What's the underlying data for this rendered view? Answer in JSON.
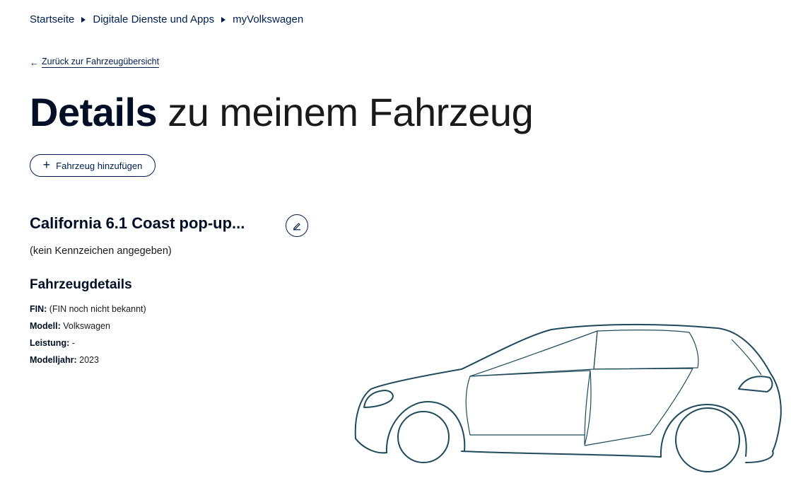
{
  "breadcrumb": {
    "items": [
      "Startseite",
      "Digitale Dienste und Apps",
      "myVolkswagen"
    ]
  },
  "back_link": {
    "label": "Zurück zur Fahrzeugübersicht",
    "icon": "arrow-left-icon"
  },
  "title": {
    "bold": "Details",
    "light": "zu meinem Fahrzeug"
  },
  "add_vehicle": {
    "label": "Fahrzeug hinzufügen",
    "icon": "plus-icon"
  },
  "vehicle": {
    "name": "California 6.1 Coast pop-up...",
    "edit_icon": "pencil-icon",
    "plate": "(kein Kennzeichen angegeben)"
  },
  "details": {
    "title": "Fahrzeugdetails",
    "fin_label": "FIN:",
    "fin_value": "(FIN noch nicht bekannt)",
    "model_label": "Modell:",
    "model_value": "Volkswagen",
    "power_label": "Leistung:",
    "power_value": "-",
    "year_label": "Modelljahr:",
    "year_value": "2023"
  },
  "colors": {
    "brand": "#001e50",
    "car_outline": "#1e4a5c"
  }
}
